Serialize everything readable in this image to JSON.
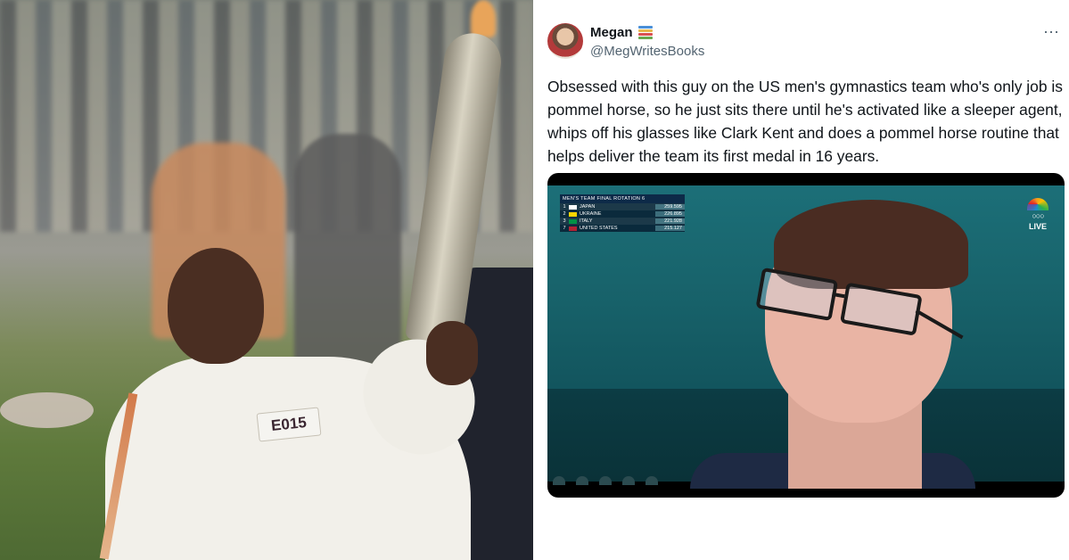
{
  "photo": {
    "bib_number": "E015"
  },
  "tweet": {
    "display_name": "Megan",
    "handle": "@MegWritesBooks",
    "more_icon": "⋯",
    "text": "Obsessed with this guy on the US men's gymnastics team who's only job is pommel horse, so he just sits there until he's activated like a sleeper agent, whips off his glasses like Clark Kent and does a pommel horse routine that helps deliver the team its first medal in 16 years.",
    "icons": {
      "name_emoji": "books-icon",
      "more": "more-options-icon"
    },
    "media": {
      "scoreboard": {
        "title": "MEN'S TEAM FINAL  ROTATION 6",
        "rows": [
          {
            "rank": "1",
            "team": "JAPAN",
            "score": "259.595",
            "flag_color": "#ffffff"
          },
          {
            "rank": "2",
            "team": "UKRAINE",
            "score": "226.895",
            "flag_color": "#ffd500"
          },
          {
            "rank": "3",
            "team": "ITALY",
            "score": "221.928",
            "flag_color": "#009246"
          },
          {
            "rank": "7",
            "team": "UNITED STATES",
            "score": "215.127",
            "flag_color": "#b22234"
          }
        ]
      },
      "broadcaster_live": "LIVE"
    }
  },
  "colors": {
    "text_primary": "#0f1419",
    "text_secondary": "#536471"
  }
}
